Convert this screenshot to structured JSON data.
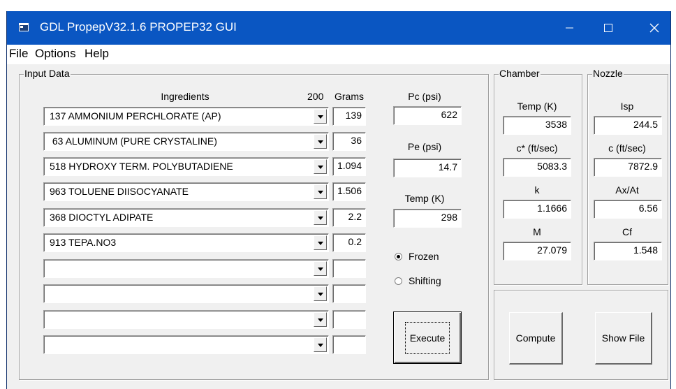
{
  "window": {
    "title": "GDL PropepV32.1.6  PROPEP32 GUI",
    "controls": {
      "minimize": "—",
      "maximize": "☐",
      "close": "✕"
    }
  },
  "menu": [
    "File",
    "Options",
    "Help"
  ],
  "input": {
    "group_label": "Input Data",
    "headers": {
      "ingredients": "Ingredients",
      "count": "200",
      "grams": "Grams"
    },
    "rows": [
      {
        "ingredient": "137 AMMONIUM PERCHLORATE (AP)",
        "grams": "139"
      },
      {
        "ingredient": " 63 ALUMINUM (PURE CRYSTALINE)",
        "grams": "36"
      },
      {
        "ingredient": "518 HYDROXY TERM. POLYBUTADIENE",
        "grams": "1.094"
      },
      {
        "ingredient": "963 TOLUENE DIISOCYANATE",
        "grams": "1.506"
      },
      {
        "ingredient": "368 DIOCTYL ADIPATE",
        "grams": "2.2"
      },
      {
        "ingredient": "913 TEPA.NO3",
        "grams": "0.2"
      },
      {
        "ingredient": "",
        "grams": ""
      },
      {
        "ingredient": "",
        "grams": ""
      },
      {
        "ingredient": "",
        "grams": ""
      },
      {
        "ingredient": "",
        "grams": ""
      }
    ],
    "pc_label": "Pc (psi)",
    "pc_value": "622",
    "pe_label": "Pe (psi)",
    "pe_value": "14.7",
    "temp_label": "Temp (K)",
    "temp_value": "298",
    "frozen_label": "Frozen",
    "shifting_label": "Shifting",
    "execute_label": "Execute"
  },
  "chamber": {
    "group_label": "Chamber",
    "temp_label": "Temp (K)",
    "temp_value": "3538",
    "cstar_label": "c* (ft/sec)",
    "cstar_value": "5083.3",
    "k_label": "k",
    "k_value": "1.1666",
    "m_label": "M",
    "m_value": "27.079"
  },
  "nozzle": {
    "group_label": "Nozzle",
    "isp_label": "Isp",
    "isp_value": "244.5",
    "c_label": "c (ft/sec)",
    "c_value": "7872.9",
    "ax_label": "Ax/At",
    "ax_value": "6.56",
    "cf_label": "Cf",
    "cf_value": "1.548"
  },
  "buttons": {
    "compute": "Compute",
    "show_file": "Show File"
  },
  "colors": {
    "titlebar": "#0a56c2",
    "face": "#f0f0f0",
    "field": "#ffffff"
  },
  "icons": [
    "app-icon",
    "minimize-icon",
    "maximize-icon",
    "close-icon",
    "dropdown-arrow-icon"
  ]
}
